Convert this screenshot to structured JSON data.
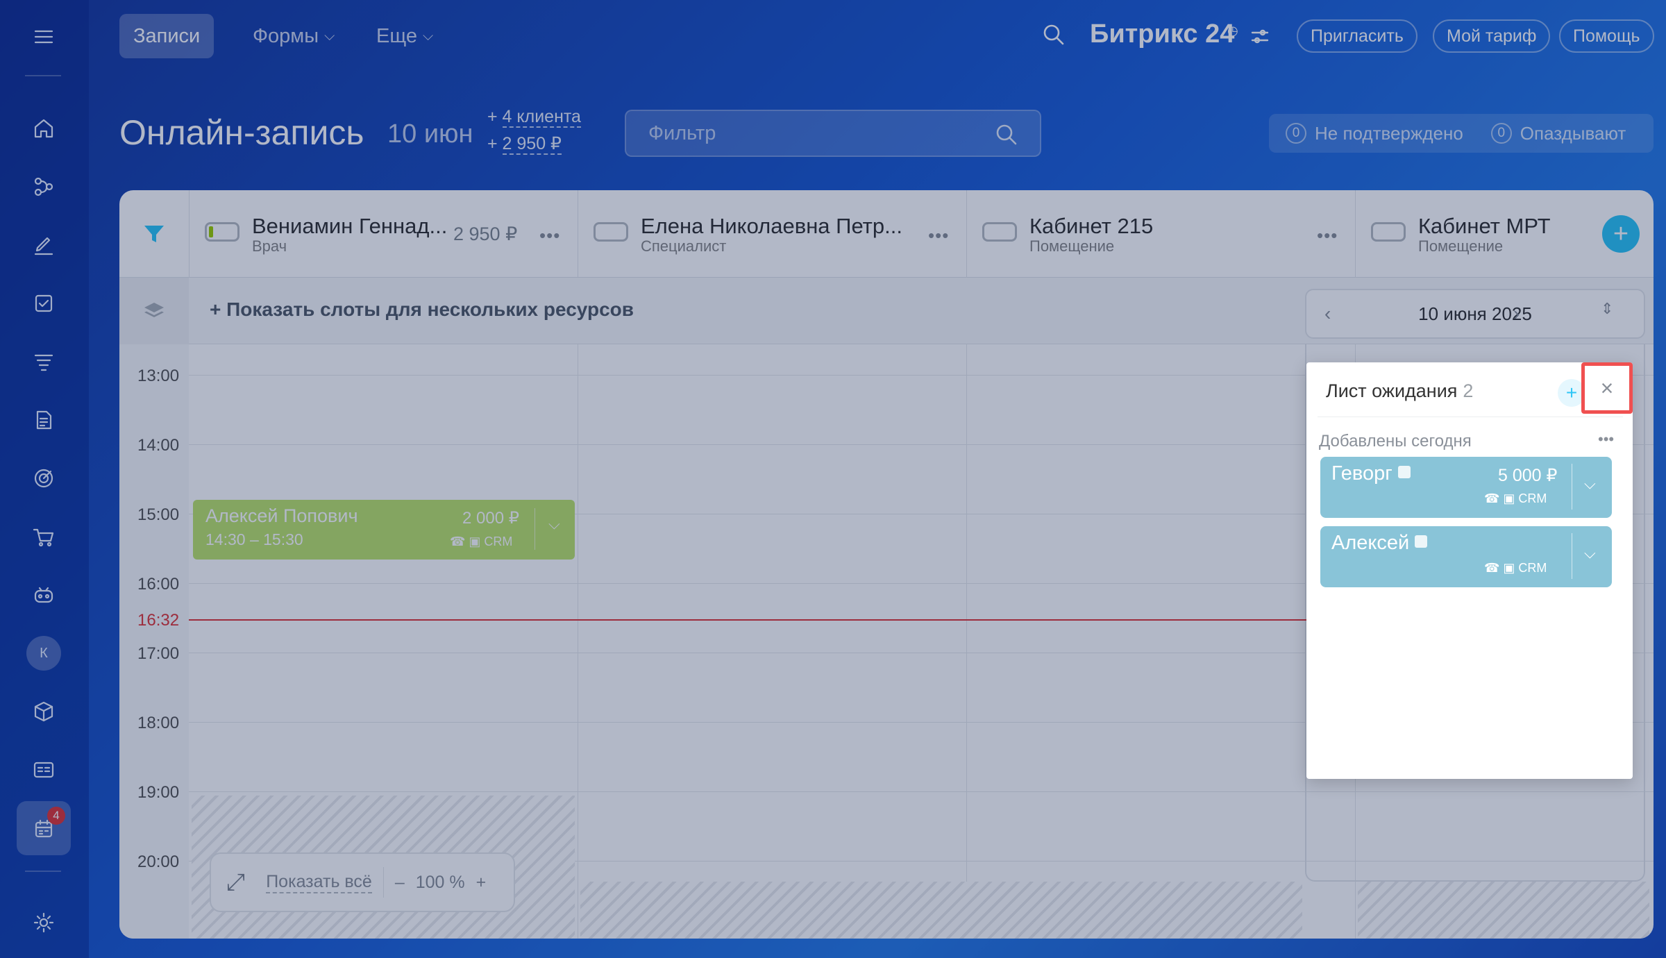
{
  "topbar": {
    "tabs": [
      {
        "label": "Записи",
        "active": true
      },
      {
        "label": "Формы",
        "dropdown": true
      },
      {
        "label": "Еще",
        "dropdown": true
      }
    ],
    "brand": "Битрикс 24",
    "invite_label": "Пригласить",
    "tariff_label": "Мой тариф",
    "help_label": "Помощь"
  },
  "sidebar": {
    "icons": [
      "menu-icon",
      "home-icon",
      "crm-icon",
      "sign-icon",
      "tasks-icon",
      "funnel-icon",
      "documents-icon",
      "goals-icon",
      "shop-icon",
      "bot-icon",
      "avatar",
      "box-icon",
      "card-icon",
      "booking-icon",
      "settings-icon"
    ],
    "avatar_letter": "К",
    "booking_badge": "4"
  },
  "header": {
    "title": "Онлайн-запись",
    "date": "10 июн",
    "clients_prefix": "+ ",
    "clients": "4 клиента",
    "revenue_prefix": "+ ",
    "revenue": "2 950 ₽",
    "filter_placeholder": "Фильтр",
    "unconfirmed_count": "0",
    "unconfirmed_label": "Не подтверждено",
    "late_count": "0",
    "late_label": "Опаздывают"
  },
  "resources": [
    {
      "name": "Вениамин Геннад...",
      "role": "Врач",
      "price": "2 950 ₽"
    },
    {
      "name": "Елена Николаевна Петр...",
      "role": "Специалист"
    },
    {
      "name": "Кабинет 215",
      "role": "Помещение"
    },
    {
      "name": "Кабинет МРТ",
      "role": "Помещение"
    }
  ],
  "slots_bar": {
    "label": "+ Показать слоты для нескольких ресурсов",
    "date": "10 июня 2025"
  },
  "times": [
    "13:00",
    "14:00",
    "15:00",
    "16:00",
    "17:00",
    "18:00",
    "19:00",
    "20:00"
  ],
  "current_time": "16:32",
  "booking": {
    "name": "Алексей Попович",
    "time": "14:30 – 15:30",
    "price": "2 000 ₽",
    "icons": "☎ ▣ CRM"
  },
  "zoom": {
    "show_all": "Показать всё",
    "minus": "–",
    "level": "100 %",
    "plus": "+"
  },
  "waitlist": {
    "title": "Лист ожидания",
    "count": "2",
    "add": "+",
    "close": "×",
    "section": "Добавлены сегодня",
    "items": [
      {
        "name": "Геворг",
        "price": "5 000 ₽",
        "icons": "☎ ▣ CRM"
      },
      {
        "name": "Алексей",
        "icons": "☎ ▣ CRM"
      }
    ]
  },
  "colors": {
    "accent": "#2fc6f6",
    "booking_green": "#bde46d",
    "waitlist_card": "#89c4d8",
    "now_line": "#e0383a",
    "highlight_border": "#f05050"
  }
}
